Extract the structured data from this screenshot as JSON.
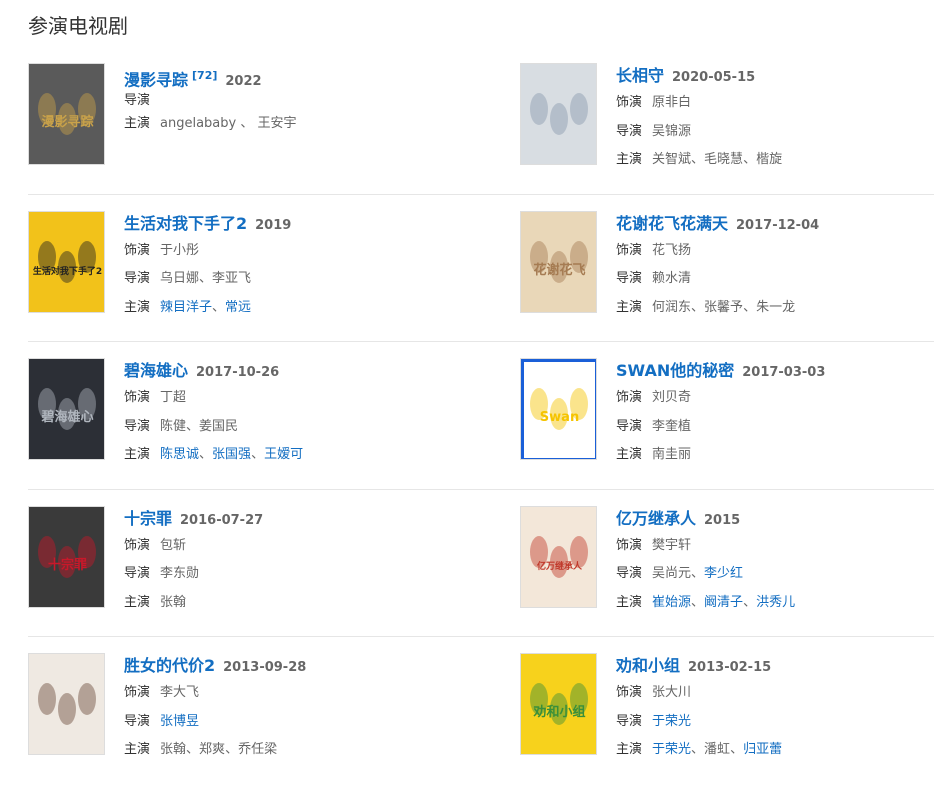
{
  "section_title": "参演电视剧",
  "items": [
    {
      "title": "漫影寻踪",
      "sup": "[72]",
      "date": "2022",
      "lines": [
        {
          "label": "导演",
          "people": []
        },
        {
          "label": "主演",
          "people": [
            {
              "name": "angelababy",
              "link": false
            },
            {
              "name": "王安宇",
              "link": false
            }
          ],
          "sep": "、"
        }
      ],
      "poster": {
        "bg": "#5a5a5a",
        "accent": "#c9a24a",
        "text": "漫影寻踪"
      }
    },
    {
      "title": "长相守",
      "date": "2020-05-15",
      "lines": [
        {
          "label": "饰演",
          "people": [
            {
              "name": "原非白",
              "link": false
            }
          ]
        },
        {
          "label": "导演",
          "people": [
            {
              "name": "吴锦源",
              "link": false
            }
          ]
        },
        {
          "label": "主演",
          "people": [
            {
              "name": "关智斌",
              "link": false
            },
            {
              "name": "毛晓慧",
              "link": false
            },
            {
              "name": "楷旋",
              "link": false
            }
          ]
        }
      ],
      "poster": {
        "bg": "#d8dde2",
        "accent": "#8a9aac",
        "text": ""
      }
    },
    {
      "title": "生活对我下手了2",
      "date": "2019",
      "lines": [
        {
          "label": "饰演",
          "people": [
            {
              "name": "于小彤",
              "link": false
            }
          ]
        },
        {
          "label": "导演",
          "people": [
            {
              "name": "乌日娜",
              "link": false
            },
            {
              "name": "李亚飞",
              "link": false
            }
          ]
        },
        {
          "label": "主演",
          "people": [
            {
              "name": "辣目洋子",
              "link": true
            },
            {
              "name": "常远",
              "link": true
            }
          ]
        }
      ],
      "poster": {
        "bg": "#f2c21a",
        "accent": "#222",
        "text": "生活对我下手了2"
      }
    },
    {
      "title": "花谢花飞花满天",
      "date": "2017-12-04",
      "lines": [
        {
          "label": "饰演",
          "people": [
            {
              "name": "花飞扬",
              "link": false
            }
          ]
        },
        {
          "label": "导演",
          "people": [
            {
              "name": "赖水清",
              "link": false
            }
          ]
        },
        {
          "label": "主演",
          "people": [
            {
              "name": "何润东",
              "link": false
            },
            {
              "name": "张馨予",
              "link": false
            },
            {
              "name": "朱一龙",
              "link": false
            }
          ]
        }
      ],
      "poster": {
        "bg": "#e9d7b8",
        "accent": "#a57b52",
        "text": "花谢花飞"
      }
    },
    {
      "title": "碧海雄心",
      "date": "2017-10-26",
      "lines": [
        {
          "label": "饰演",
          "people": [
            {
              "name": "丁超",
              "link": false
            }
          ]
        },
        {
          "label": "导演",
          "people": [
            {
              "name": "陈健",
              "link": false
            },
            {
              "name": "姜国民",
              "link": false
            }
          ]
        },
        {
          "label": "主演",
          "people": [
            {
              "name": "陈思诚",
              "link": true
            },
            {
              "name": "张国强",
              "link": true
            },
            {
              "name": "王嫒可",
              "link": true
            }
          ]
        }
      ],
      "poster": {
        "bg": "#2c2f36",
        "accent": "#b0b6be",
        "text": "碧海雄心"
      }
    },
    {
      "title": "SWAN他的秘密",
      "date": "2017-03-03",
      "lines": [
        {
          "label": "饰演",
          "people": [
            {
              "name": "刘贝奇",
              "link": false
            }
          ]
        },
        {
          "label": "导演",
          "people": [
            {
              "name": "李奎植",
              "link": false
            }
          ]
        },
        {
          "label": "主演",
          "people": [
            {
              "name": "南圭丽",
              "link": false
            }
          ]
        }
      ],
      "poster": {
        "bg": "#ffffff",
        "accent": "#f5c400",
        "text": "Swan",
        "border": "#1a5fd8"
      }
    },
    {
      "title": "十宗罪",
      "date": "2016-07-27",
      "lines": [
        {
          "label": "饰演",
          "people": [
            {
              "name": "包斩",
              "link": false
            }
          ]
        },
        {
          "label": "导演",
          "people": [
            {
              "name": "李东勋",
              "link": false
            }
          ]
        },
        {
          "label": "主演",
          "people": [
            {
              "name": "张翰",
              "link": false
            }
          ]
        }
      ],
      "poster": {
        "bg": "#3a3a3a",
        "accent": "#c8182a",
        "text": "十宗罪"
      }
    },
    {
      "title": "亿万继承人",
      "date": "2015",
      "lines": [
        {
          "label": "饰演",
          "people": [
            {
              "name": "樊宇轩",
              "link": false
            }
          ]
        },
        {
          "label": "导演",
          "people": [
            {
              "name": "吴尚元",
              "link": false
            },
            {
              "name": "李少红",
              "link": true
            }
          ]
        },
        {
          "label": "主演",
          "people": [
            {
              "name": "崔始源",
              "link": true
            },
            {
              "name": "阚清子",
              "link": true
            },
            {
              "name": "洪秀儿",
              "link": true
            }
          ]
        }
      ],
      "poster": {
        "bg": "#f3e7d9",
        "accent": "#c0392b",
        "text": "亿万继承人"
      }
    },
    {
      "title": "胜女的代价2",
      "date": "2013-09-28",
      "lines": [
        {
          "label": "饰演",
          "people": [
            {
              "name": "李大飞",
              "link": false
            }
          ]
        },
        {
          "label": "导演",
          "people": [
            {
              "name": "张博昱",
              "link": true
            }
          ]
        },
        {
          "label": "主演",
          "people": [
            {
              "name": "张翰",
              "link": false
            },
            {
              "name": "郑爽",
              "link": false
            },
            {
              "name": "乔任梁",
              "link": false
            }
          ]
        }
      ],
      "poster": {
        "bg": "#efe9e2",
        "accent": "#6a4a3a",
        "text": ""
      }
    },
    {
      "title": "劝和小组",
      "date": "2013-02-15",
      "lines": [
        {
          "label": "饰演",
          "people": [
            {
              "name": "张大川",
              "link": false
            }
          ]
        },
        {
          "label": "导演",
          "people": [
            {
              "name": "于荣光",
              "link": true
            }
          ]
        },
        {
          "label": "主演",
          "people": [
            {
              "name": "于荣光",
              "link": true
            },
            {
              "name": "潘虹",
              "link": false
            },
            {
              "name": "归亚蕾",
              "link": true
            }
          ]
        }
      ],
      "poster": {
        "bg": "#f7d21c",
        "accent": "#3a8f3a",
        "text": "劝和小组"
      }
    }
  ]
}
